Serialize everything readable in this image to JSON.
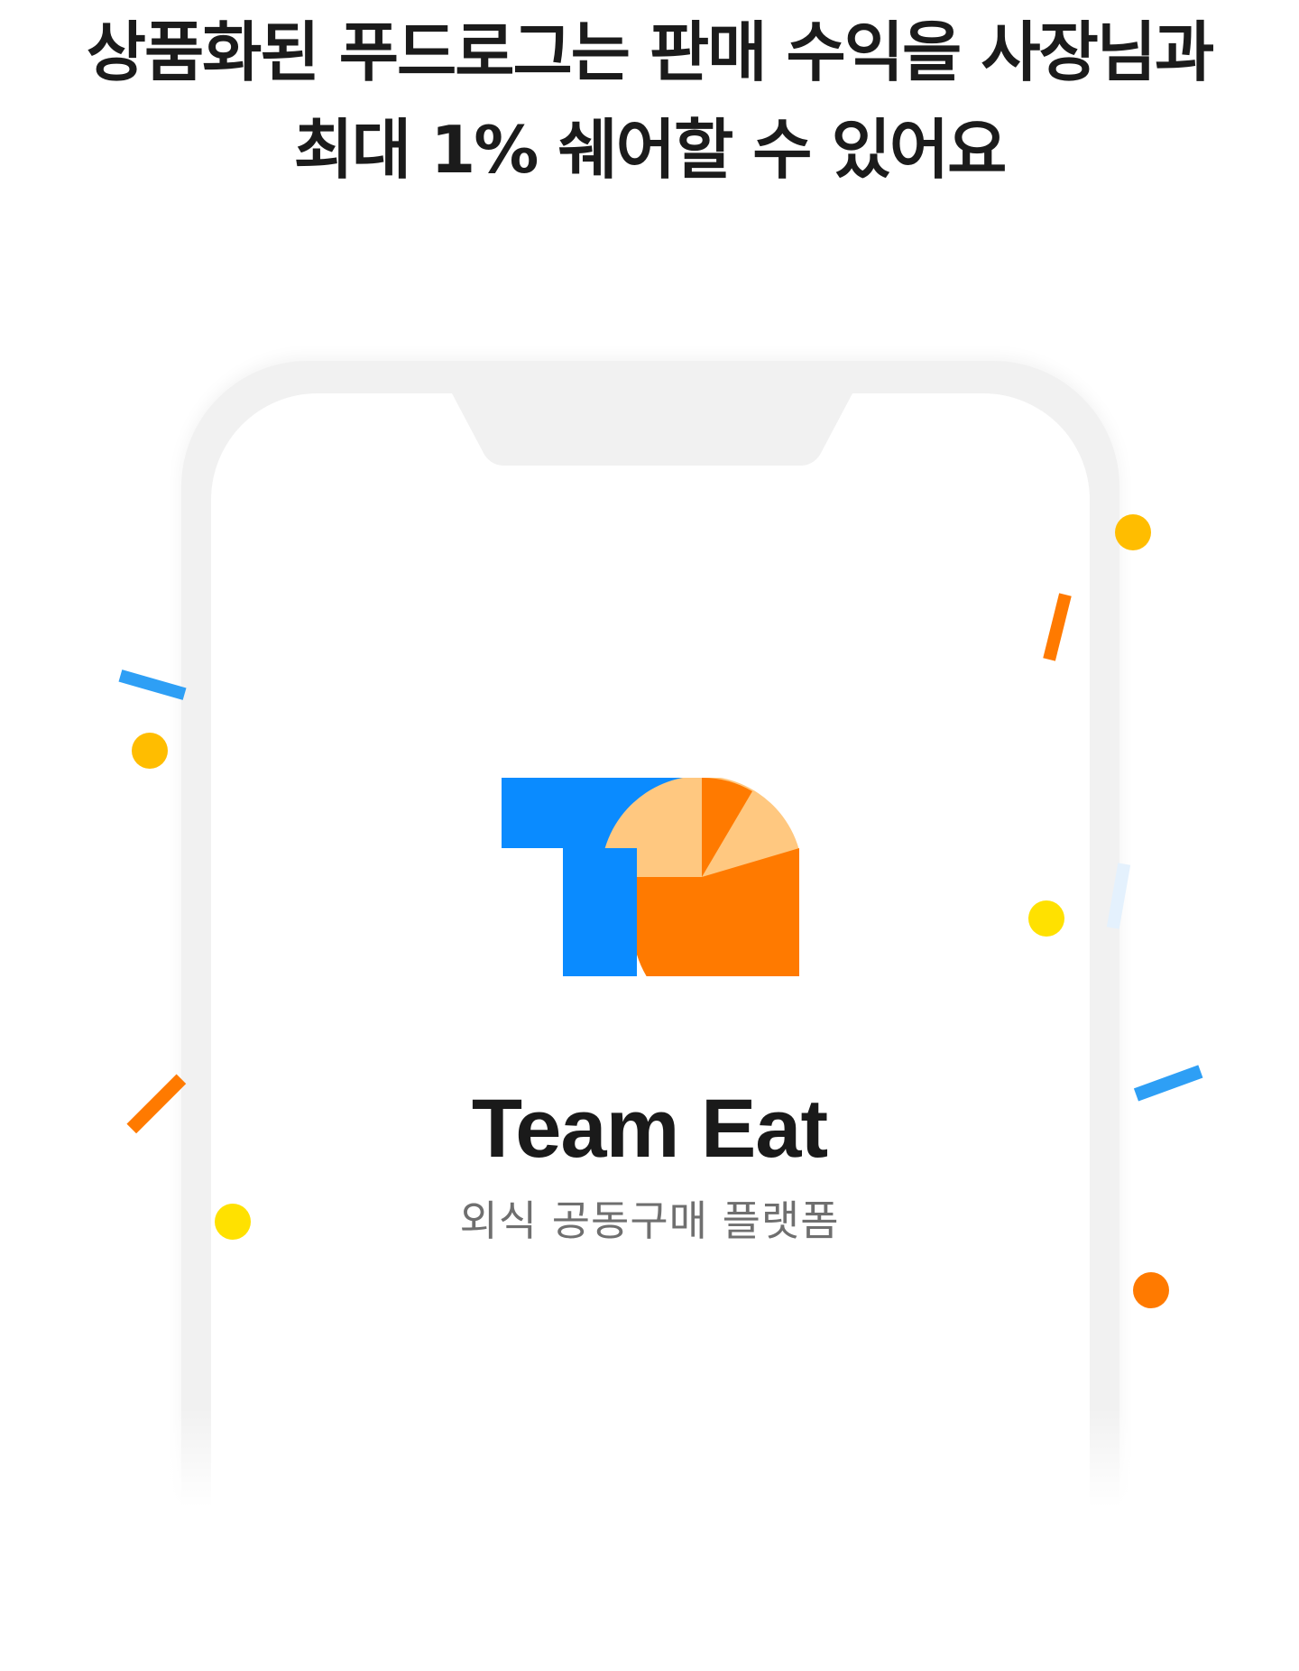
{
  "headline": {
    "line1": "상품화된 푸드로그는 판매 수익을 사장님과",
    "line2": "최대 1% 쉐어할 수 있어요"
  },
  "app": {
    "name": "Team Eat",
    "tagline": "외식 공동구매 플랫폼",
    "logo_icon": "team-eat-logo-icon"
  },
  "colors": {
    "logo_blue": "#0a8bff",
    "logo_orange": "#ff7a00",
    "logo_peach": "#ffc880",
    "confetti_blue": "#2e9ff5",
    "confetti_orange": "#ff7a00",
    "confetti_gold": "#ffbd00",
    "confetti_yellow": "#ffe100",
    "confetti_light_blue": "#e4f1fd"
  }
}
